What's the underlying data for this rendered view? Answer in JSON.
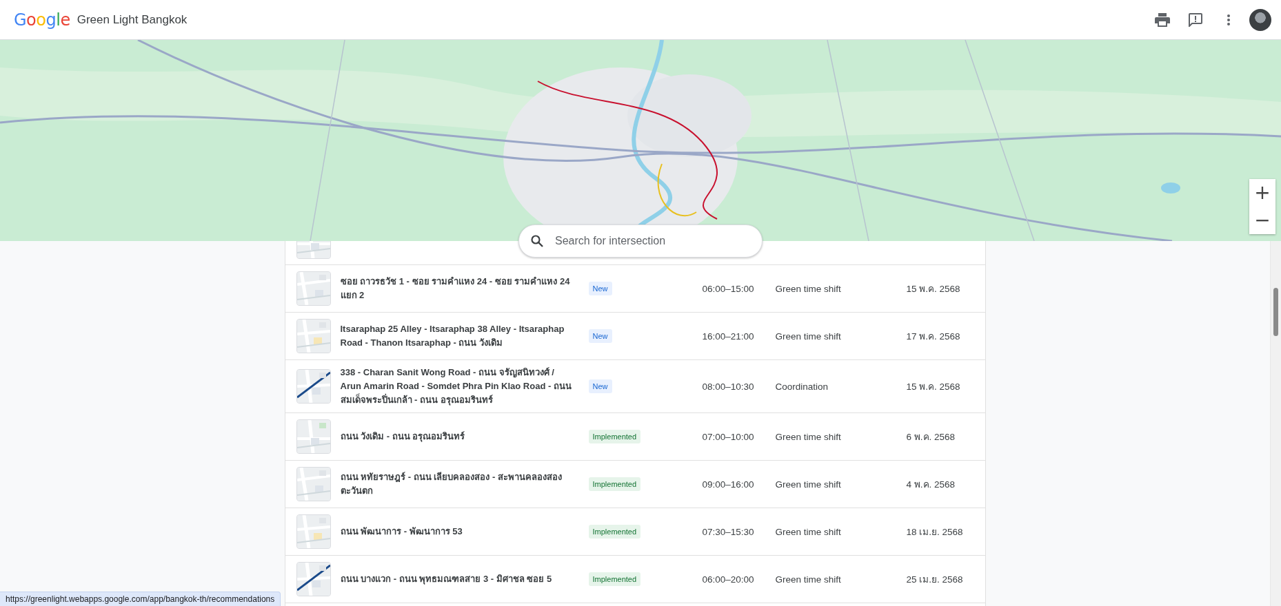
{
  "header": {
    "logo": "Google",
    "title": "Green Light Bangkok"
  },
  "map": {
    "search": {
      "placeholder": "Search for intersection"
    },
    "zoom_in": "+",
    "zoom_out": "−"
  },
  "table": {
    "rows": [
      {
        "name": "ซอย ถาวรธวัช 1 - ซอย รามคำแหง 24 - ซอย รามคำแหง 24 แยก 2",
        "status": {
          "label": "New",
          "kind": "new"
        },
        "time": "06:00–15:00",
        "type": "Green time shift",
        "date": "15 พ.ค. 2568"
      },
      {
        "name": "Itsaraphap 25 Alley - Itsaraphap 38 Alley - Itsaraphap Road - Thanon Itsaraphap - ถนน วังเดิม",
        "status": {
          "label": "New",
          "kind": "new"
        },
        "time": "16:00–21:00",
        "type": "Green time shift",
        "date": "17 พ.ค. 2568"
      },
      {
        "name": "338 - Charan Sanit Wong Road - ถนน จรัญสนิทวงศ์ / Arun Amarin Road - Somdet Phra Pin Klao Road - ถนน สมเด็จพระปิ่นเกล้า - ถนน อรุณอมรินทร์",
        "status": {
          "label": "New",
          "kind": "new"
        },
        "time": "08:00–10:30",
        "type": "Coordination",
        "date": "15 พ.ค. 2568"
      },
      {
        "name": "ถนน วังเดิม - ถนน อรุณอมรินทร์",
        "status": {
          "label": "Implemented",
          "kind": "implemented"
        },
        "time": "07:00–10:00",
        "type": "Green time shift",
        "date": "6 พ.ค. 2568"
      },
      {
        "name": "ถนน หทัยราษฎร์ - ถนน เลียบคลองสอง - สะพานคลองสองตะวันตก",
        "status": {
          "label": "Implemented",
          "kind": "implemented"
        },
        "time": "09:00–16:00",
        "type": "Green time shift",
        "date": "4 พ.ค. 2568"
      },
      {
        "name": "ถนน พัฒนาการ - พัฒนาการ 53",
        "status": {
          "label": "Implemented",
          "kind": "implemented"
        },
        "time": "07:30–15:30",
        "type": "Green time shift",
        "date": "18 เม.ย. 2568"
      },
      {
        "name": "ถนน บางแวก - ถนน พุทธมณฑลสาย 3 - มิศาชล ซอย 5",
        "status": {
          "label": "Implemented",
          "kind": "implemented"
        },
        "time": "06:00–20:00",
        "type": "Green time shift",
        "date": "25 เม.ย. 2568"
      }
    ]
  },
  "status_url": "https://greenlight.webapps.google.com/app/bangkok-th/recommendations"
}
